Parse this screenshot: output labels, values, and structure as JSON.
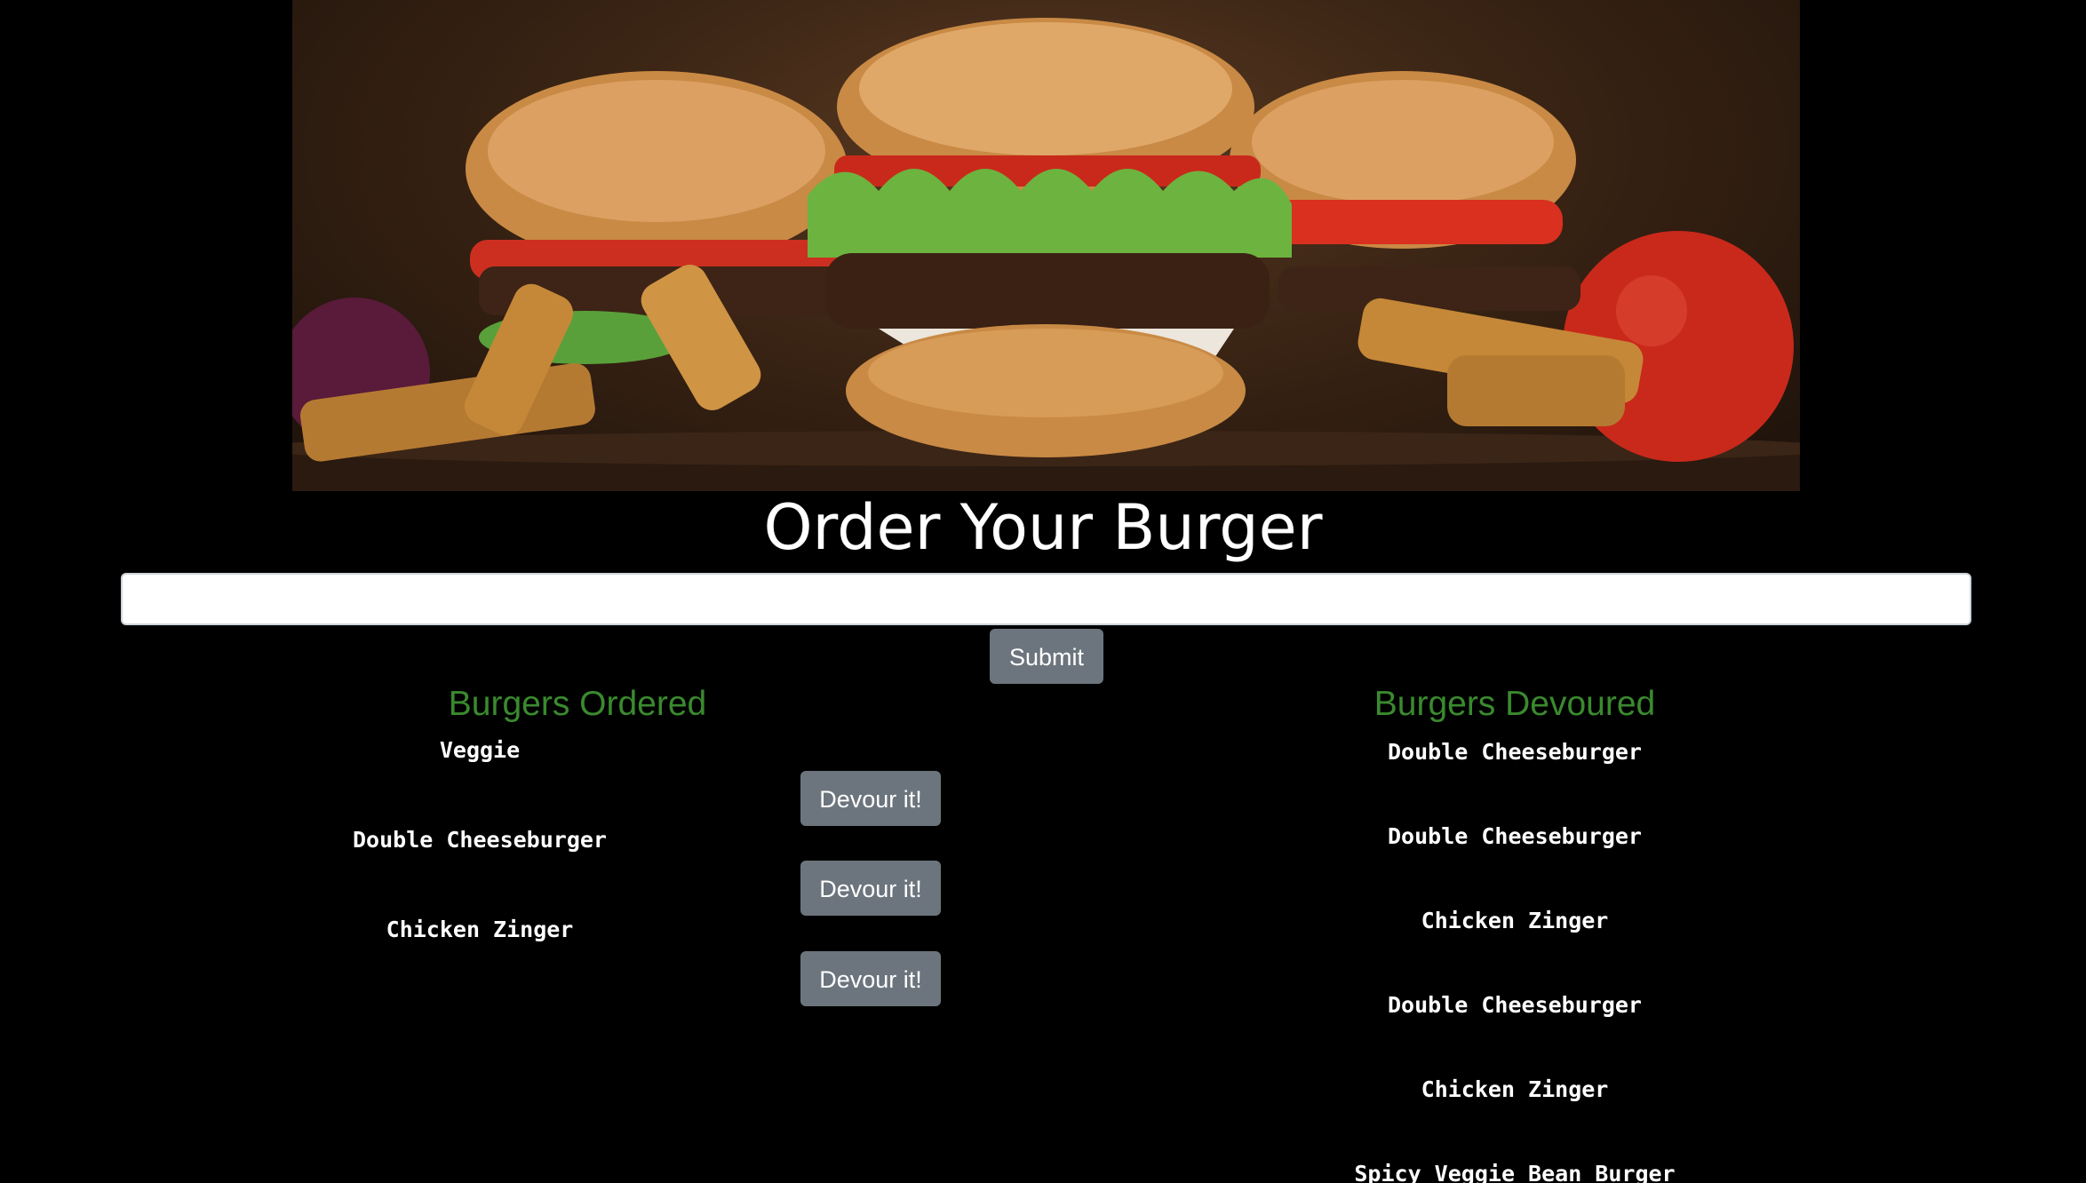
{
  "hero": {
    "image_alt": "burgers"
  },
  "header": {
    "title": "Order Your Burger"
  },
  "order_form": {
    "input_value": "",
    "input_placeholder": "",
    "submit_label": "Submit"
  },
  "ordered": {
    "heading": "Burgers Ordered",
    "items": [
      {
        "name": "Veggie",
        "button_label": "Devour it!"
      },
      {
        "name": "Double Cheeseburger",
        "button_label": "Devour it!"
      },
      {
        "name": "Chicken Zinger",
        "button_label": "Devour it!"
      }
    ]
  },
  "devoured": {
    "heading": "Burgers Devoured",
    "items": [
      "Double Cheeseburger",
      "Double Cheeseburger",
      "Chicken Zinger",
      "Double Cheeseburger",
      "Chicken Zinger",
      "Spicy Veggie Bean Burger"
    ]
  },
  "colors": {
    "background": "#000000",
    "heading_green": "#3a8a2e",
    "button_gray": "#6c757d"
  }
}
